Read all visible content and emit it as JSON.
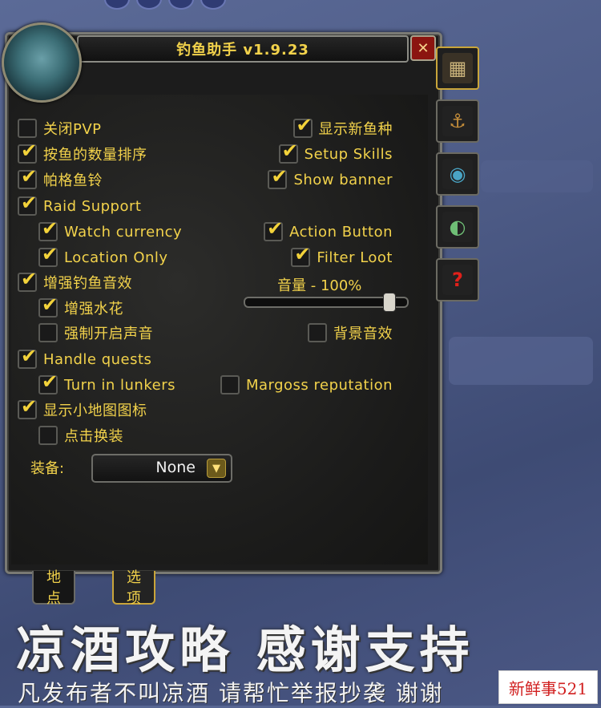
{
  "window": {
    "title": "钓鱼助手 v1.9.23",
    "close_glyph": "✕"
  },
  "side_tabs": [
    {
      "icon": "treasure-map-icon",
      "glyph": "▦",
      "color": "#c9b27a"
    },
    {
      "icon": "fishing-poles-icon",
      "glyph": "⚓",
      "color": "#c48d3a"
    },
    {
      "icon": "lure-eye-icon",
      "glyph": "◉",
      "color": "#4aa4c4"
    },
    {
      "icon": "fish-head-icon",
      "glyph": "◐",
      "color": "#6fbf76"
    },
    {
      "icon": "help-question-icon",
      "glyph": "?",
      "color": "#e0201a"
    }
  ],
  "left_options": [
    {
      "label": "关闭PVP",
      "checked": false
    },
    {
      "label": "按鱼的数量排序",
      "checked": true
    },
    {
      "label": "帕格鱼铃",
      "checked": true
    },
    {
      "label": "Raid Support",
      "checked": true
    },
    {
      "label": "Watch currency",
      "checked": true
    },
    {
      "label": "Location Only",
      "checked": true
    },
    {
      "label": "增强钓鱼音效",
      "checked": true
    },
    {
      "label": "增强水花",
      "checked": true
    },
    {
      "label": "强制开启声音",
      "checked": false
    },
    {
      "label": "Handle quests",
      "checked": true
    },
    {
      "label": "Turn in lunkers",
      "checked": true
    },
    {
      "label": "显示小地图图标",
      "checked": true
    },
    {
      "label": "点击换装",
      "checked": false
    }
  ],
  "right_options": [
    {
      "label": "显示新鱼种",
      "checked": true
    },
    {
      "label": "Setup Skills",
      "checked": true
    },
    {
      "label": "Show banner",
      "checked": true
    },
    {
      "label": "Action Button",
      "checked": true
    },
    {
      "label": "Filter Loot",
      "checked": true
    },
    {
      "label": "背景音效",
      "checked": false
    },
    {
      "label": "Margoss reputation",
      "checked": false
    }
  ],
  "volume": {
    "label": "音量 - 100%",
    "level": 1.0
  },
  "equip": {
    "label": "装备:",
    "value": "None"
  },
  "bottom_tabs": [
    {
      "label": "地点",
      "active": false
    },
    {
      "label": "选项",
      "active": true
    }
  ],
  "overlay": {
    "headline": "凉酒攻略 感谢支持",
    "subline": "凡发布者不叫凉酒 请帮忙举报抄袭 谢谢",
    "watermark": "新鲜事521"
  }
}
